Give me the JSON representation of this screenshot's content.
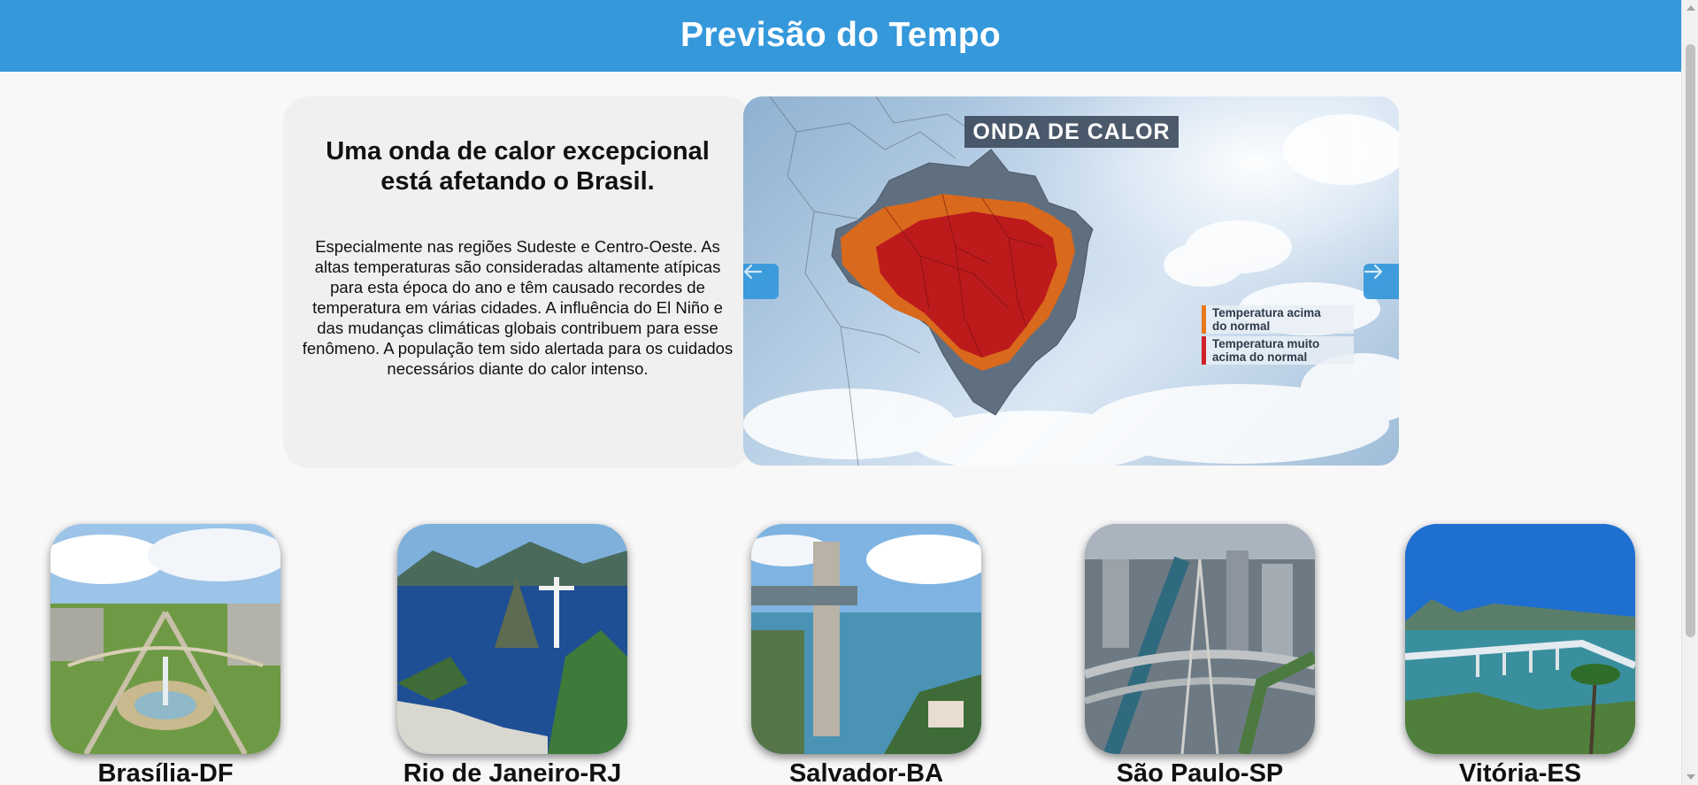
{
  "header": {
    "title": "Previsão do Tempo"
  },
  "hero": {
    "heading": "Uma onda de calor excepcional está afetando o Brasil.",
    "body": "Especialmente nas regiões Sudeste e Centro-Oeste. As altas temperaturas são consideradas altamente atípicas para esta época do ano e têm causado recordes de temperatura em várias cidades. A influência do El Niño e das mudanças climáticas globais contribuem para esse fenômeno. A população tem sido alertada para os cuidados necessários diante do calor intenso."
  },
  "slider": {
    "image_title": "ONDA DE CALOR",
    "legend": [
      {
        "line1": "Temperatura acima",
        "line2": "do normal",
        "color": "#e8781e"
      },
      {
        "line1": "Temperatura muito",
        "line2": "acima do normal",
        "color": "#d0202a"
      }
    ],
    "prev_icon": "arrow-left-icon",
    "next_icon": "arrow-right-icon"
  },
  "cities": [
    {
      "name": "Brasília-DF"
    },
    {
      "name": "Rio de Janeiro-RJ"
    },
    {
      "name": "Salvador-BA"
    },
    {
      "name": "São Paulo-SP"
    },
    {
      "name": "Vitória-ES"
    }
  ]
}
